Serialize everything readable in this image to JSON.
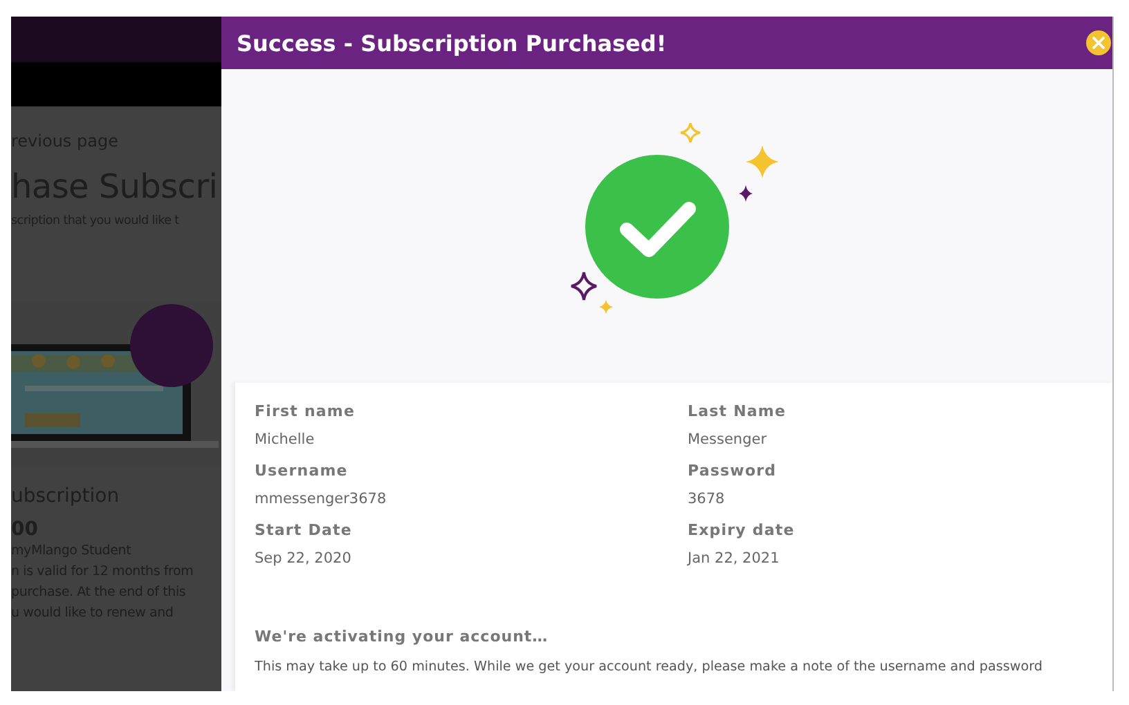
{
  "background_page": {
    "back_link": "revious page",
    "heading": "hase Subscri",
    "subheading": "scription that you would like t",
    "plan_title": "ubscription",
    "price": "00",
    "plan_name": "myMlango Student",
    "description_lines": [
      "n is valid for 12 months from",
      "purchase. At the end of this",
      "u would like to renew and"
    ]
  },
  "modal": {
    "title": "Success - Subscription Purchased!",
    "fields": [
      {
        "label": "First name",
        "value": "Michelle"
      },
      {
        "label": "Last Name",
        "value": "Messenger"
      },
      {
        "label": "Username",
        "value": "mmessenger3678"
      },
      {
        "label": "Password",
        "value": "3678"
      },
      {
        "label": "Start Date",
        "value": "Sep 22, 2020"
      },
      {
        "label": "Expiry date",
        "value": "Jan 22, 2021"
      }
    ],
    "notice_title": "We're activating your account…",
    "notice_text": "This may take up to 60 minutes. While we get your account ready, please make a note of the username and password"
  }
}
